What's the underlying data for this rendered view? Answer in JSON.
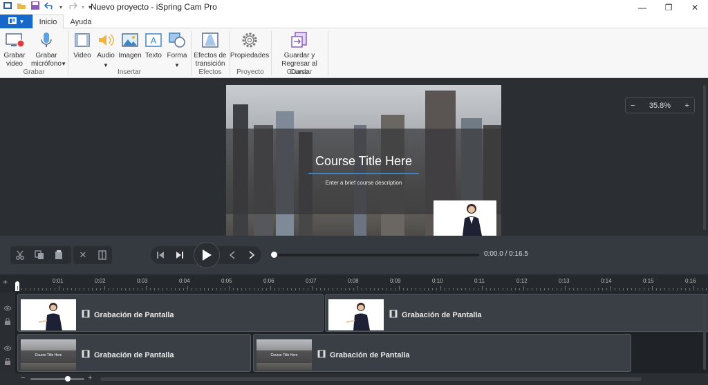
{
  "window": {
    "title": "Nuevo proyecto - iSpring Cam Pro"
  },
  "tabs": [
    {
      "label": "Inicio",
      "active": true
    },
    {
      "label": "Ayuda",
      "active": false
    }
  ],
  "ribbon": {
    "grabar_video": "Grabar video",
    "grabar_microfono": "Grabar micrófono",
    "video": "Video",
    "audio": "Audio",
    "imagen": "Imagen",
    "texto": "Texto",
    "forma": "Forma",
    "efectos": "Efectos de transición",
    "propiedades": "Propiedades",
    "guardar": "Guardar y Regresar al Curso",
    "groups": {
      "grabar": "Grabar",
      "insertar": "Insertar",
      "efectos": "Efectos",
      "proyecto": "Proyecto",
      "guardar": "Guardar"
    }
  },
  "preview": {
    "course_title": "Course Title Here",
    "course_desc": "Enter a brief course description",
    "zoom": "35.8%"
  },
  "playback": {
    "time": "0:00.0 / 0:16.5",
    "progress": 0
  },
  "ruler": [
    "0:01",
    "0:02",
    "0:03",
    "0:04",
    "0:05",
    "0:06",
    "0:07",
    "0:08",
    "0:09",
    "0:10",
    "0:11",
    "0:12",
    "0:13",
    "0:14",
    "0:15",
    "0:16"
  ],
  "clips": {
    "c1": "Grabación de Pantalla",
    "c2": "Grabación de Pantalla",
    "c3": "Grabación de Pantalla",
    "c4": "Grabación de Pantalla"
  },
  "thumb_title": "Course Title Here"
}
